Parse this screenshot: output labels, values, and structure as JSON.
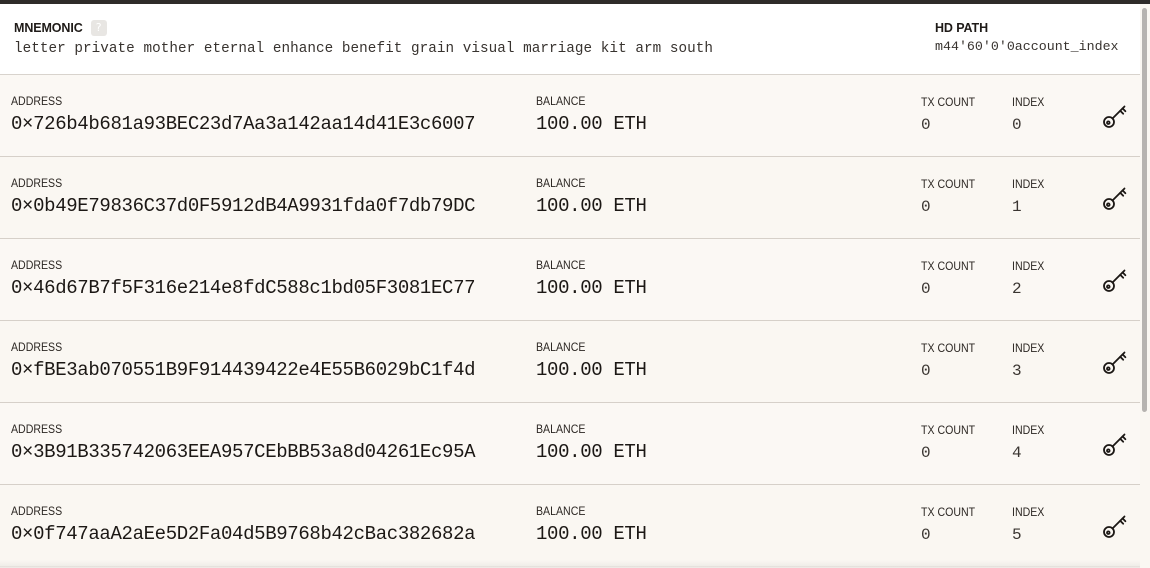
{
  "header": {
    "mnemonic_label": "MNEMONIC",
    "mnemonic_help": "?",
    "mnemonic_phrase": "letter private mother eternal enhance benefit grain visual marriage kit arm south",
    "hd_path_label": "HD PATH",
    "hd_path_value": "m44'60'0'0account_index"
  },
  "labels": {
    "address": "ADDRESS",
    "balance": "BALANCE",
    "tx_count": "TX COUNT",
    "index": "INDEX"
  },
  "accounts": [
    {
      "address": "0×726b4b681a93BEC23d7Aa3a142aa14d41E3c6007",
      "balance": "100.00 ETH",
      "tx_count": "0",
      "index": "0"
    },
    {
      "address": "0×0b49E79836C37d0F5912dB4A9931fda0f7db79DC",
      "balance": "100.00 ETH",
      "tx_count": "0",
      "index": "1"
    },
    {
      "address": "0×46d67B7f5F316e214e8fdC588c1bd05F3081EC77",
      "balance": "100.00 ETH",
      "tx_count": "0",
      "index": "2"
    },
    {
      "address": "0×fBE3ab070551B9F914439422e4E55B6029bC1f4d",
      "balance": "100.00 ETH",
      "tx_count": "0",
      "index": "3"
    },
    {
      "address": "0×3B91B335742063EEA957CEbBB53a8d04261Ec95A",
      "balance": "100.00 ETH",
      "tx_count": "0",
      "index": "4"
    },
    {
      "address": "0×0f747aaA2aEe5D2Fa04d5B9768b42cBac382682a",
      "balance": "100.00 ETH",
      "tx_count": "0",
      "index": "5"
    }
  ],
  "icons": {
    "key_icon": "key-icon",
    "help_icon": "help-icon"
  },
  "colors": {
    "background": "#faf7f2",
    "header_background": "#ffffff",
    "top_bar": "#2e2b29",
    "text": "#1c1815"
  }
}
